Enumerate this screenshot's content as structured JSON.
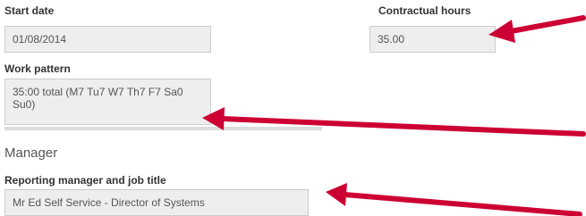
{
  "start_date": {
    "label": "Start date",
    "value": "01/08/2014"
  },
  "contractual_hours": {
    "label": "Contractual hours",
    "value": "35.00"
  },
  "work_pattern": {
    "label": "Work pattern",
    "value": "35:00 total (M7 Tu7 W7 Th7 F7 Sa0 Su0)"
  },
  "manager_section": {
    "title": "Manager"
  },
  "reporting_manager": {
    "label": "Reporting manager and job title",
    "value": "Mr Ed Self Service - Director of Systems"
  },
  "colors": {
    "arrow": "#cc0033",
    "field_bg": "#eeeeee",
    "field_border": "#cccccc"
  }
}
